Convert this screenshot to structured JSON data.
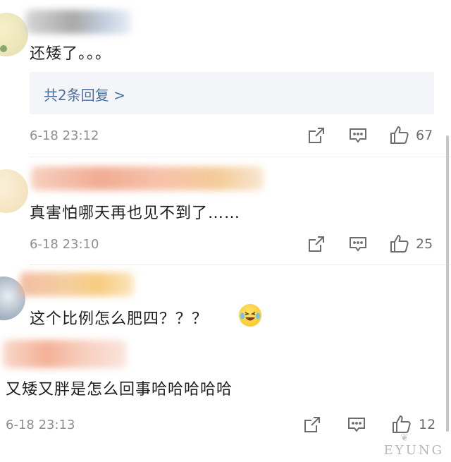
{
  "comments": [
    {
      "text": "还矮了。。。",
      "reply_link": "共2条回复 >",
      "time": "6-18 23:12",
      "likes": "67",
      "icons": [
        "share-icon",
        "comment-icon",
        "like-icon"
      ]
    },
    {
      "text": "真害怕哪天再也见不到了……",
      "time": "6-18 23:10",
      "likes": "25",
      "icons": [
        "share-icon",
        "comment-icon",
        "like-icon"
      ]
    },
    {
      "text": "这个比例怎么肥四？？？",
      "emoji": "laughing-crying-emoji"
    },
    {
      "text": "又矮又胖是怎么回事哈哈哈哈哈",
      "time": "6-18 23:13",
      "likes": "12",
      "icons": [
        "share-icon",
        "comment-icon",
        "like-icon"
      ]
    }
  ],
  "watermark": "EYUNG",
  "colors": {
    "reply_link": "#4d6f9d",
    "reply_bg": "#f3f5f8",
    "muted": "#8e8e8e",
    "text": "#1e1e1e"
  }
}
